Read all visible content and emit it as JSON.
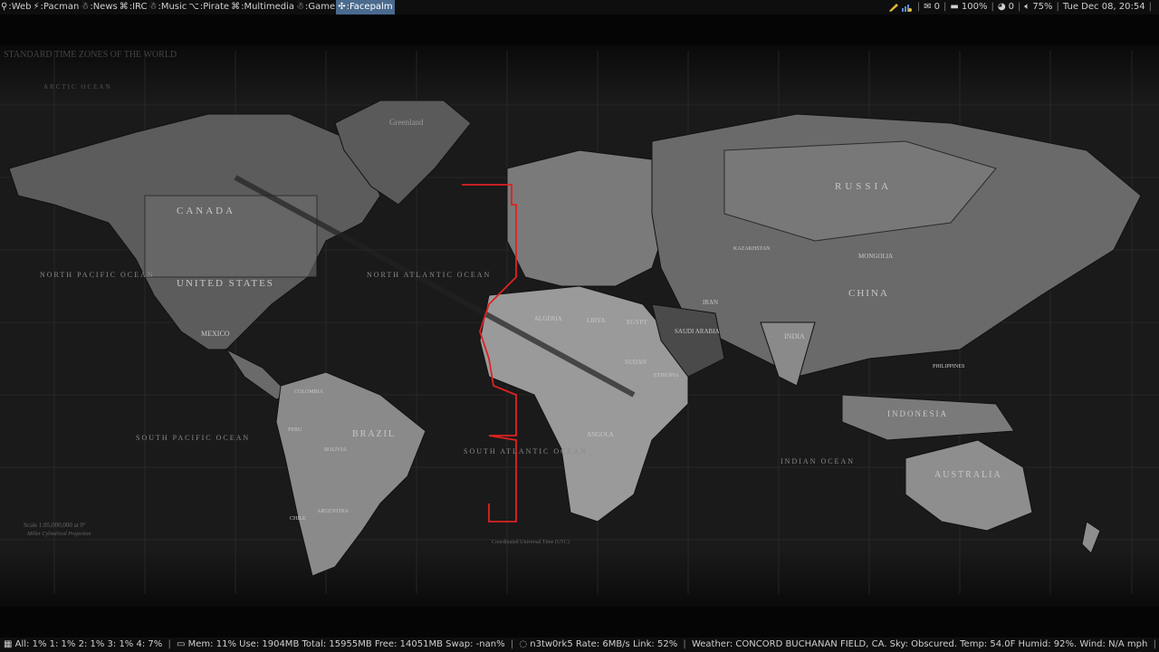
{
  "taskbar": {
    "tags": [
      {
        "glyph": "⚲",
        "label": "Web"
      },
      {
        "glyph": "⚡",
        "label": "Pacman"
      },
      {
        "glyph": "☃",
        "label": "News"
      },
      {
        "glyph": "⌘",
        "label": "IRC"
      },
      {
        "glyph": "☃",
        "label": "Music"
      },
      {
        "glyph": "⌥",
        "label": "Pirate"
      },
      {
        "glyph": "⌘",
        "label": "Multimedia"
      },
      {
        "glyph": "☃",
        "label": "Game"
      },
      {
        "glyph": "✣",
        "label": "Facepalm"
      }
    ],
    "active_tag": "Facepalm",
    "mail_count": "0",
    "battery": "100%",
    "updates": "0",
    "volume": "75%",
    "clock": "Tue Dec 08, 20:54"
  },
  "map": {
    "title": "STANDARD TIME ZONES OF THE WORLD",
    "labels": {
      "canada": "CANADA",
      "united_states": "UNITED STATES",
      "mexico": "MEXICO",
      "greenland": "Greenland",
      "russia": "RUSSIA",
      "china": "CHINA",
      "mongolia": "MONGOLIA",
      "kazakhstan": "KAZAKHSTAN",
      "india": "INDIA",
      "iran": "IRAN",
      "brazil": "BRAZIL",
      "bolivia": "BOLIVIA",
      "argentina": "ARGENTINA",
      "chile": "CHILE",
      "peru": "PERU",
      "colombia": "COLOMBIA",
      "algeria": "ALGERIA",
      "libya": "LIBYA",
      "egypt": "EGYPT",
      "sudan": "SUDAN",
      "saudi_arabia": "SAUDI ARABIA",
      "ethiopia": "ETHIOPIA",
      "angola": "ANGOLA",
      "australia": "AUSTRALIA",
      "indonesia": "INDONESIA",
      "philippines": "PHILIPPINES",
      "north_pacific": "NORTH PACIFIC OCEAN",
      "south_pacific": "SOUTH PACIFIC OCEAN",
      "north_atlantic": "NORTH ATLANTIC OCEAN",
      "south_atlantic": "SOUTH ATLANTIC OCEAN",
      "indian_ocean": "INDIAN OCEAN",
      "arctic_ocean": "ARCTIC OCEAN",
      "scale": "Scale 1:85,000,000 at 0°",
      "projection": "Miller Cylindrical Projection",
      "utc_note": "Coordinated Universal Time (UTC)"
    }
  },
  "statusbar": {
    "cpu": "All: 1% 1: 1% 2: 1% 3: 1% 4: 7%",
    "mem": "Mem: 11% Use: 1904MB Total: 15955MB Free: 14051MB Swap: -nan%",
    "net": "n3tw0rk5 Rate: 6MB/s Link: 52%",
    "weather": "Weather: CONCORD BUCHANAN FIELD, CA. Sky: Obscured. Temp: 54.0F Humid: 92%. Wind: N/A mph"
  }
}
